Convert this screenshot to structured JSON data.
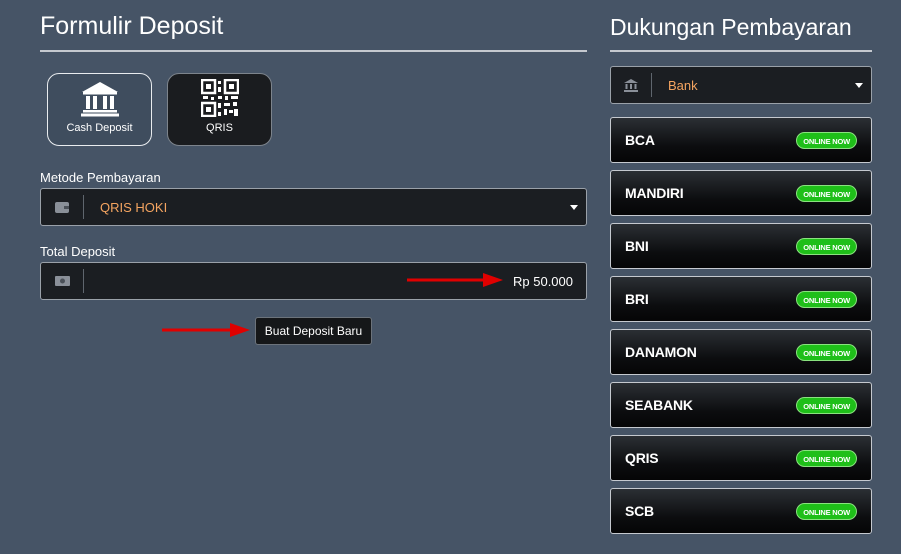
{
  "deposit_form": {
    "title": "Formulir Deposit",
    "tabs": [
      {
        "label": "Cash Deposit",
        "icon": "bank-icon"
      },
      {
        "label": "QRIS",
        "icon": "qr-code-icon"
      }
    ],
    "payment_method": {
      "label": "Metode Pembayaran",
      "selected": "QRIS HOKI"
    },
    "total": {
      "label": "Total Deposit",
      "value": "Rp 50.000"
    },
    "submit_label": "Buat Deposit Baru"
  },
  "payment_support": {
    "title": "Dukungan Pembayaran",
    "filter": {
      "selected": "Bank"
    },
    "banks": [
      {
        "name": "BCA",
        "status": "ONLINE NOW"
      },
      {
        "name": "MANDIRI",
        "status": "ONLINE NOW"
      },
      {
        "name": "BNI",
        "status": "ONLINE NOW"
      },
      {
        "name": "BRI",
        "status": "ONLINE NOW"
      },
      {
        "name": "DANAMON",
        "status": "ONLINE NOW"
      },
      {
        "name": "SEABANK",
        "status": "ONLINE NOW"
      },
      {
        "name": "QRIS",
        "status": "ONLINE NOW"
      },
      {
        "name": "SCB",
        "status": "ONLINE NOW"
      }
    ]
  },
  "colors": {
    "background": "#465466",
    "accent_orange": "#f4a460",
    "online_green": "#1fbf19",
    "annotation_arrow": "#e00000"
  }
}
